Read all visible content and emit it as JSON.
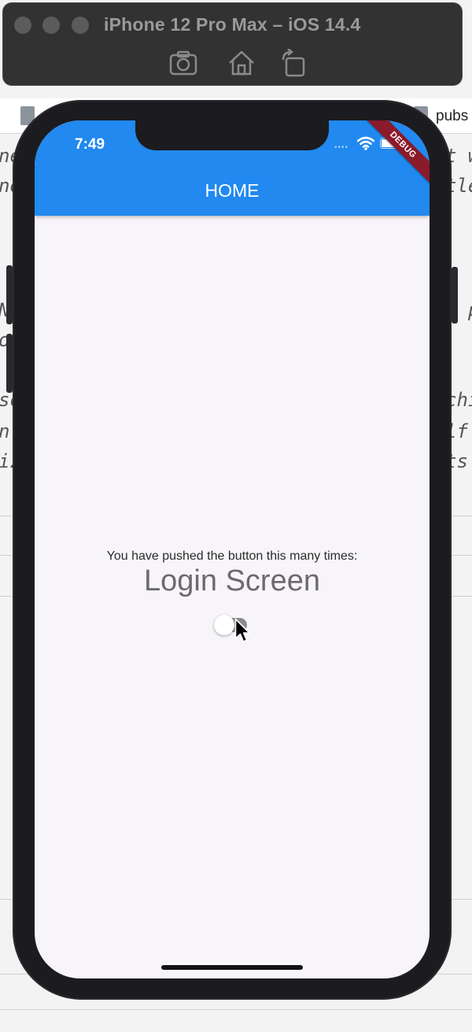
{
  "simulator": {
    "title": "iPhone 12 Pro Max – iOS 14.4",
    "tools": [
      "screenshot-icon",
      "home-icon",
      "rotate-icon"
    ]
  },
  "editor": {
    "tab_label": "pubs",
    "code_lines": [
      {
        "left": "ne",
        "right": "t w"
      },
      {
        "left": "ne",
        "right": "tle"
      },
      {
        "left": "Ne",
        "right": "l p"
      },
      {
        "left": "or",
        "right": ""
      },
      {
        "left": "so",
        "right": "chi"
      },
      {
        "left": "n",
        "right": "lf"
      },
      {
        "left": "iz",
        "right": "ts"
      }
    ]
  },
  "status_bar": {
    "time": "7:49",
    "dots": "••••"
  },
  "app": {
    "title": "HOME",
    "debug_banner": "DEBUG",
    "counter_label": "You have pushed the button this many times:",
    "heading": "Login Screen",
    "toggle_on": false
  },
  "colors": {
    "appbar": "#2189ef",
    "debug_banner": "#8b1a2b",
    "screen_bg": "#f7f5f9",
    "heading_text": "#6c6a70"
  }
}
